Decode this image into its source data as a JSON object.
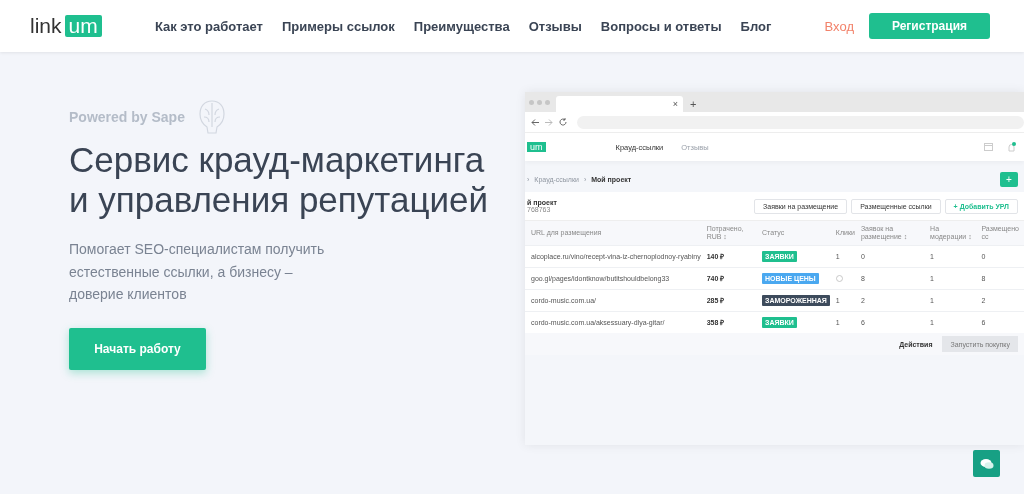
{
  "header": {
    "logo": {
      "text": "link",
      "badge": "um"
    },
    "nav": [
      "Как это работает",
      "Примеры ссылок",
      "Преимущества",
      "Отзывы",
      "Вопросы и ответы",
      "Блог"
    ],
    "login": "Вход",
    "register": "Регистрация"
  },
  "hero": {
    "powered": "Powered by Sape",
    "title": "Сервис крауд-маркетинга и управления репутацией",
    "subtitle": "Помогает SEO-специалистам получить естественные ссылки, а бизнесу – доверие клиентов",
    "cta": "Начать работу"
  },
  "mockup": {
    "browser": {
      "tab_close": "×",
      "new_tab": "+"
    },
    "app": {
      "logo": "um",
      "tabs": [
        {
          "label": "Крауд-ссылки",
          "selected": true
        },
        {
          "label": "Отзывы",
          "selected": false
        }
      ],
      "breadcrumb_separator": "›",
      "breadcrumbs": [
        "Крауд-ссылки",
        "Мой проект"
      ],
      "add_button": "+",
      "project": {
        "title": "й проект",
        "id": "768763"
      },
      "actions": [
        "Заявки на размещение",
        "Размещенные ссылки"
      ],
      "add_url_icon": "+",
      "add_url": "Добавить УРЛ",
      "table": {
        "columns": [
          "URL для размещения",
          "Потрачено, RUB ↕",
          "Статус",
          "Клики",
          "Заявок на размещение ↕",
          "На модерации ↕",
          "Размещено сс"
        ],
        "rows": [
          {
            "url": "alcoplace.ru/vino/recept-vina-iz-chernoplodnoy-ryabiny",
            "spent": "140 ₽",
            "status": "ЗАЯВКИ",
            "color": "#1fbf8f",
            "clicks": "1",
            "requests": "0",
            "moderation": "1",
            "placed": "0"
          },
          {
            "url": "goo.gl/pages/idontknow/butitshouldbelong33",
            "spent": "740 ₽",
            "status": "НОВЫЕ ЦЕНЫ",
            "color": "#4aa8f0",
            "requests": "8",
            "moderation": "1",
            "placed": "8"
          },
          {
            "url": "cordo-music.com.ua/",
            "spent": "285 ₽",
            "status": "ЗАМОРОЖЕННАЯ",
            "color": "#3d4b5c",
            "clicks": "1",
            "requests": "2",
            "moderation": "1",
            "placed": "2"
          },
          {
            "url": "cordo-music.com.ua/aksessuary-dlya-gitar/",
            "spent": "358 ₽",
            "status": "ЗАЯВКИ",
            "color": "#1fbf8f",
            "clicks": "1",
            "requests": "6",
            "moderation": "1",
            "placed": "6"
          }
        ]
      },
      "footer": {
        "actions": "Действия",
        "buy": "Запустить покупку"
      }
    }
  }
}
